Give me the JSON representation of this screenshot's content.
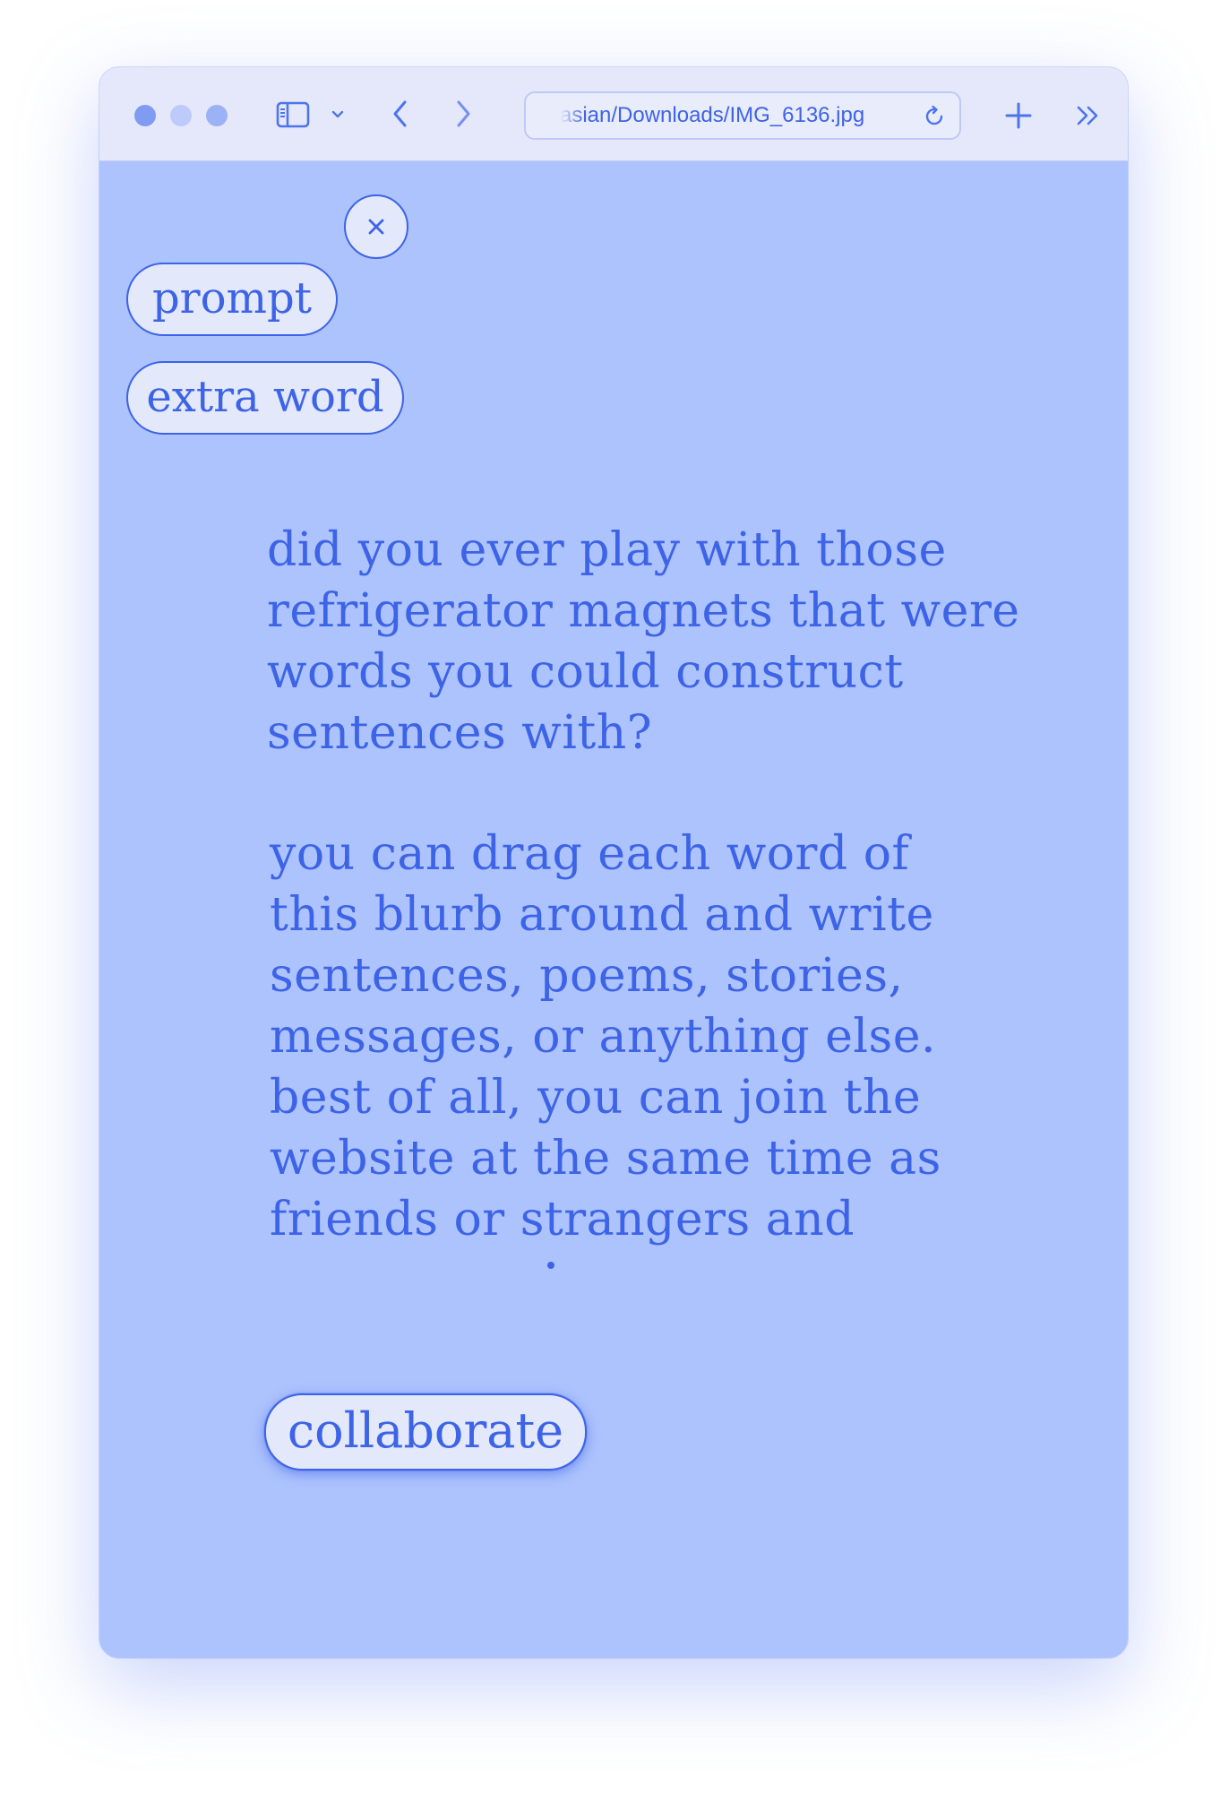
{
  "browser": {
    "url": "asian/Downloads/IMG_6136.jpg"
  },
  "buttons": {
    "close_label": "×",
    "prompt_label": "prompt",
    "extra_word_label": "extra word",
    "collaborate_label": "collaborate"
  },
  "blurb": {
    "paragraph1": [
      "did you ever play with those",
      "refrigerator magnets that were",
      "words you could construct",
      "sentences with?"
    ],
    "paragraph2": [
      "you can drag each word of",
      "this blurb around and write",
      "sentences, poems, stories,",
      "messages, or anything else.",
      "best of all, you can join the",
      "website at the same time as",
      "friends or strangers and"
    ]
  },
  "colors": {
    "page_background": "#adc3fd",
    "accent": "#3d63e6",
    "button_fill": "#e3e8fb",
    "titlebar": "#e5e8fa"
  },
  "icons": {
    "titlebar": [
      "sidebar-toggle-icon",
      "chevron-down-icon",
      "back-arrow-icon",
      "forward-arrow-icon",
      "reload-icon",
      "new-tab-plus-icon",
      "more-chevrons-icon"
    ],
    "content": [
      "close-icon"
    ]
  }
}
